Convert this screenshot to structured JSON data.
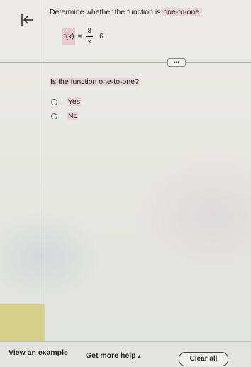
{
  "question": {
    "prefix": "Determine whether the function is ",
    "highlight": "one-to-one.",
    "formula": {
      "lhs": "f(x)",
      "equals": "=",
      "numerator": "8",
      "denominator": "x",
      "tail": "−6"
    },
    "more_label": "•••"
  },
  "prompt": "Is the function one-to-one?",
  "options": [
    {
      "label": "Yes",
      "selected": false
    },
    {
      "label": "No",
      "selected": false
    }
  ],
  "footer": {
    "view_example": "View an example",
    "get_more_help": "Get more help",
    "get_more_help_caret": "▴",
    "clear_all": "Clear all"
  },
  "colors": {
    "highlight_pink": "#e7c8cf",
    "sidebar_highlight": "#d8cf8b"
  }
}
